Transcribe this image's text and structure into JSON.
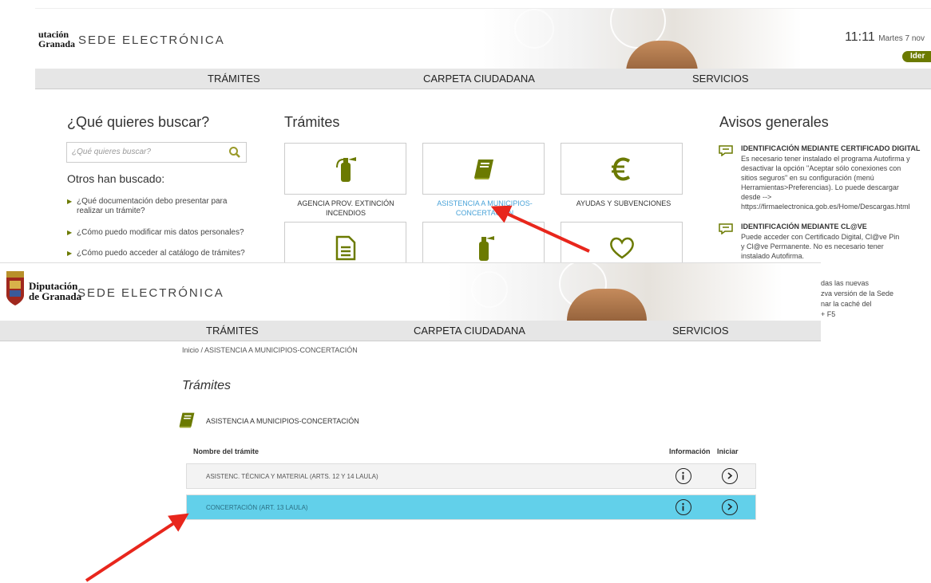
{
  "top": {
    "logo_line1": "utación",
    "logo_line2": "Granada",
    "sede": "SEDE ELECTRÓNICA",
    "time": "11:11",
    "date": "Martes 7 nov",
    "ident_button": "Ider",
    "nav": [
      "TRÁMITES",
      "CARPETA CIUDADANA",
      "SERVICIOS"
    ],
    "search_heading": "¿Qué quieres buscar?",
    "search_placeholder": "¿Qué quieres buscar?",
    "others_heading": "Otros han buscado:",
    "questions": [
      "¿Qué documentación debo presentar para realizar un trámite?",
      "¿Cómo puedo modificar mis datos personales?",
      "¿Cómo puedo acceder al catálogo de trámites?"
    ],
    "tramites_heading": "Trámites",
    "tiles": [
      {
        "label": "AGENCIA PROV. EXTINCIÓN INCENDIOS",
        "icon": "fire-extinguisher-icon"
      },
      {
        "label": "ASISTENCIA A MUNICIPIOS-CONCERTACIÓN",
        "icon": "book-icon"
      },
      {
        "label": "AYUDAS Y SUBVENCIONES",
        "icon": "euro-icon"
      },
      {
        "label": "",
        "icon": "document-icon"
      },
      {
        "label": "",
        "icon": "fire-extinguisher-icon"
      },
      {
        "label": "",
        "icon": "heart-icon"
      }
    ],
    "avisos_heading": "Avisos generales",
    "avisos": [
      {
        "title": "IDENTIFICACIÓN MEDIANTE CERTIFICADO DIGITAL",
        "lines": [
          "Es necesario tener instalado el programa Autofirma y",
          "desactivar la opción \"Aceptar sólo conexiones con",
          "sitios seguros\" en su configuración (menú",
          "Herramientas>Preferencias). Lo puede descargar",
          "desde -->",
          "https://firmaelectronica.gob.es/Home/Descargas.html"
        ]
      },
      {
        "title": "IDENTIFICACIÓN MEDIANTE CL@VE",
        "lines": [
          "Puede acceder con Certificado Digital, Cl@ve Pin",
          "y Cl@ve Permanente. No es necesario tener",
          "instalado Autofirma."
        ]
      }
    ],
    "peek_lines": [
      "das las nuevas",
      "zva versión de la Sede",
      "nar la caché del",
      "+ F5"
    ]
  },
  "bottom": {
    "logo_line1": "Diputación",
    "logo_line2": "de Granada",
    "sede": "SEDE ELECTRÓNICA",
    "nav": [
      "TRÁMITES",
      "CARPETA CIUDADANA",
      "SERVICIOS"
    ],
    "breadcrumb": "Inicio  /  ASISTENCIA A MUNICIPIOS-CONCERTACIÓN",
    "page_title": "Trámites",
    "category": "ASISTENCIA A MUNICIPIOS-CONCERTACIÓN",
    "columns": {
      "name": "Nombre del trámite",
      "info": "Información",
      "start": "Iniciar"
    },
    "rows": [
      {
        "label": "ASISTENC. TÉCNICA Y MATERIAL (ARTS. 12 Y 14 LAULA)",
        "selected": false
      },
      {
        "label": "CONCERTACIÓN (ART. 13 LAULA)",
        "selected": true
      }
    ]
  },
  "colors": {
    "brand_olive": "#6b7a00",
    "selected_row": "#62d0ea",
    "link_blue": "#4aa3d8",
    "annotation_arrow": "#e8261c"
  }
}
